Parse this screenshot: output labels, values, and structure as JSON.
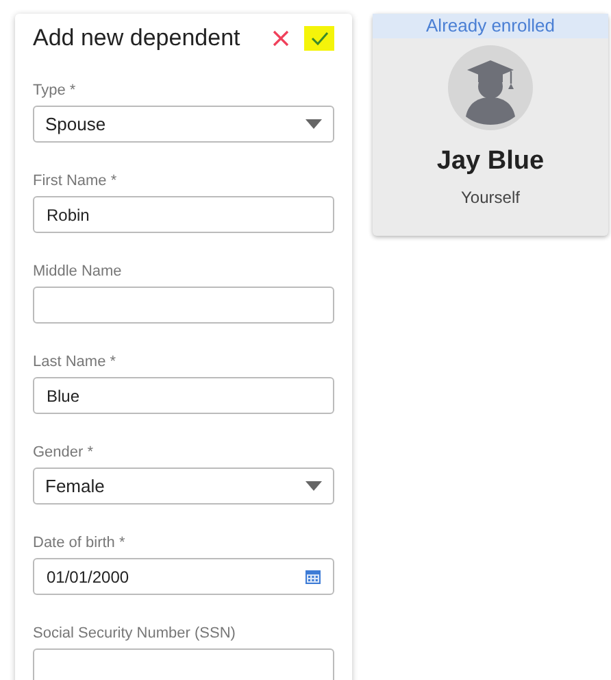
{
  "form": {
    "title": "Add new dependent",
    "fields": [
      {
        "kind": "select",
        "label": "Type *",
        "value": "Spouse"
      },
      {
        "kind": "text",
        "label": "First Name *",
        "value": "Robin"
      },
      {
        "kind": "text",
        "label": "Middle Name"
      },
      {
        "kind": "text",
        "label": "Last Name *",
        "value": "Blue"
      },
      {
        "kind": "select",
        "label": "Gender *",
        "value": "Female"
      },
      {
        "kind": "date",
        "label": "Date of birth *",
        "value": "01/01/2000"
      },
      {
        "kind": "text",
        "label": "Social Security Number (SSN)"
      }
    ]
  },
  "enrolled": {
    "banner": "Already enrolled",
    "name": "Jay Blue",
    "relation": "Yourself"
  }
}
